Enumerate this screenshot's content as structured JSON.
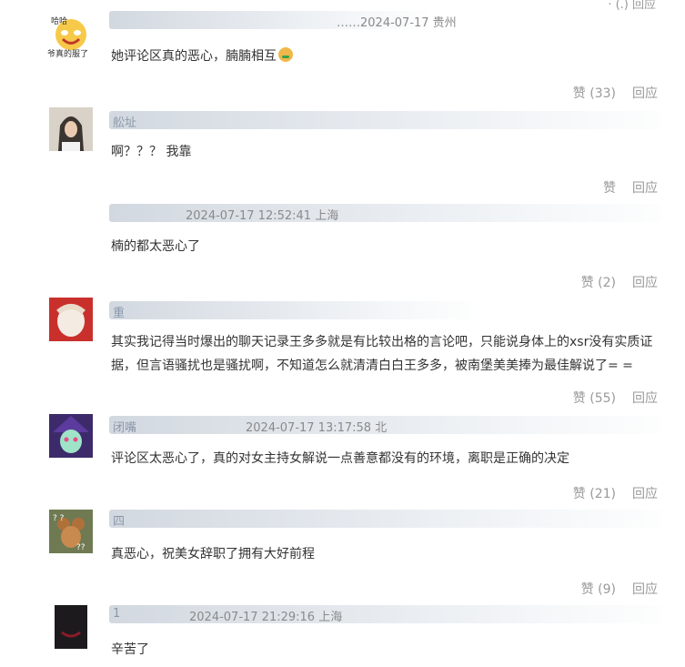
{
  "top_fragment": "· (.) 回应",
  "comments": [
    {
      "username": "",
      "meta": "……2024-07-17 贵州",
      "text": "她评论区真的恶心，腩腩相互",
      "emoji": "nauseated-face-emoji",
      "like_label": "赞 (33)",
      "reply_label": "回应",
      "avatar_badge_top": "哈哈",
      "avatar_badge": "爷真的服了"
    },
    {
      "username": "舩址",
      "meta": "",
      "text": "啊？？？ 我靠",
      "like_label": "赞",
      "reply_label": "回应"
    },
    {
      "username": "",
      "meta": "2024-07-17 12:52:41 上海",
      "text": "楠的都太恶心了",
      "like_label": "赞 (2)",
      "reply_label": "回应"
    },
    {
      "username": "重",
      "meta": "",
      "text": "其实我记得当时爆出的聊天记录王多多就是有比较出格的言论吧，只能说身体上的xsr没有实质证据，但言语骚扰也是骚扰啊，不知道怎么就清清白白王多多，被南堡美美捧为最佳解说了= =",
      "like_label": "赞 (55)",
      "reply_label": "回应"
    },
    {
      "username": "闭嘴",
      "meta": "2024-07-17 13:17:58 北",
      "text": "评论区太恶心了，真的对女主持女解说一点善意都没有的环境，离职是正确的决定",
      "like_label": "赞 (21)",
      "reply_label": "回应"
    },
    {
      "username": "四",
      "meta": "",
      "text": "真恶心，祝美女辞职了拥有大好前程",
      "like_label": "赞 (9)",
      "reply_label": "回应"
    },
    {
      "username": "1",
      "meta": "2024-07-17 21:29:16 上海",
      "text": "辛苦了",
      "like_label": "",
      "reply_label": ""
    }
  ]
}
